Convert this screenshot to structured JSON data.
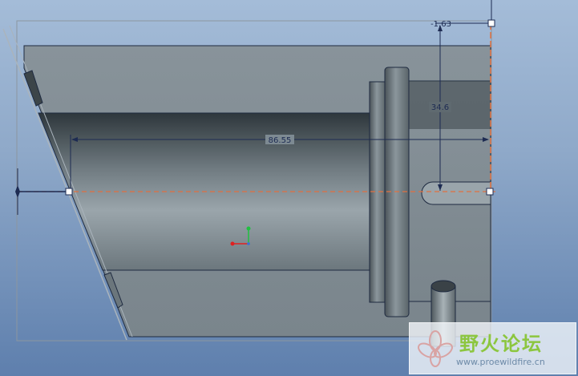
{
  "dimensions": {
    "offset_label": "-1.63",
    "height_label": "34.6",
    "length_label": "86.55"
  },
  "watermark": {
    "title": "野火论坛",
    "url": "www.proewildfire.cn"
  },
  "colors": {
    "background_top": "#a4bcd8",
    "background_bottom": "#5e7fad",
    "part_gray": "#7d8a92",
    "dimension_line": "#1d2b52",
    "sketch_line": "#e07040",
    "axis_x": "#e02020",
    "axis_y": "#20c040"
  }
}
